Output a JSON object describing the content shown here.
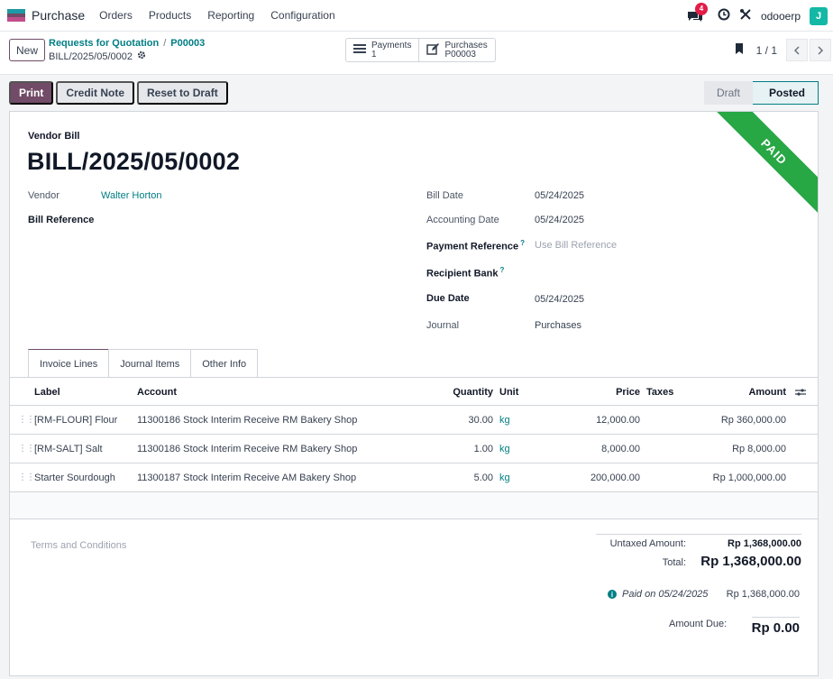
{
  "navbar": {
    "app_name": "Purchase",
    "menu": [
      "Orders",
      "Products",
      "Reporting",
      "Configuration"
    ],
    "chat_count": "4",
    "db_name": "odooerp",
    "avatar_initial": "J"
  },
  "control": {
    "new_label": "New",
    "breadcrumb": [
      "Requests for Quotation",
      "P00003"
    ],
    "breadcrumb_sep": "/",
    "record_name": "BILL/2025/05/0002",
    "smart_buttons": [
      {
        "label": "Payments",
        "value": "1",
        "icon": "list-icon"
      },
      {
        "label": "Purchases",
        "value": "P00003",
        "icon": "edit-icon"
      }
    ],
    "pager": "1 / 1"
  },
  "actions": {
    "print": "Print",
    "credit_note": "Credit Note",
    "reset_to_draft": "Reset to Draft"
  },
  "status": {
    "draft": "Draft",
    "posted": "Posted"
  },
  "ribbon": "PAID",
  "form": {
    "move_type": "Vendor Bill",
    "name": "BILL/2025/05/0002",
    "vendor_label": "Vendor",
    "vendor": "Walter Horton",
    "bill_reference_label": "Bill Reference",
    "bill_date_label": "Bill Date",
    "bill_date": "05/24/2025",
    "accounting_date_label": "Accounting Date",
    "accounting_date": "05/24/2025",
    "payment_reference_label": "Payment Reference",
    "payment_reference_placeholder": "Use Bill Reference",
    "recipient_bank_label": "Recipient Bank",
    "help_mark": "?",
    "due_date_label": "Due Date",
    "due_date": "05/24/2025",
    "journal_label": "Journal",
    "journal": "Purchases"
  },
  "tabs": [
    "Invoice Lines",
    "Journal Items",
    "Other Info"
  ],
  "lines": {
    "headers": {
      "label": "Label",
      "account": "Account",
      "quantity": "Quantity",
      "unit": "Unit",
      "price": "Price",
      "taxes": "Taxes",
      "amount": "Amount"
    },
    "rows": [
      {
        "label": "[RM-FLOUR] Flour",
        "account": "11300186 Stock Interim Receive RM Bakery Shop",
        "quantity": "30.00",
        "unit": "kg",
        "price": "12,000.00",
        "amount": "Rp 360,000.00"
      },
      {
        "label": "[RM-SALT] Salt",
        "account": "11300186 Stock Interim Receive RM Bakery Shop",
        "quantity": "1.00",
        "unit": "kg",
        "price": "8,000.00",
        "amount": "Rp 8,000.00"
      },
      {
        "label": "Starter Sourdough",
        "account": "11300187 Stock Interim Receive AM Bakery Shop",
        "quantity": "5.00",
        "unit": "kg",
        "price": "200,000.00",
        "amount": "Rp 1,000,000.00"
      }
    ]
  },
  "footer": {
    "terms_placeholder": "Terms and Conditions",
    "untaxed_label": "Untaxed Amount:",
    "untaxed_value": "Rp 1,368,000.00",
    "total_label": "Total:",
    "total_value": "Rp 1,368,000.00",
    "paid_text": "Paid on 05/24/2025",
    "paid_amount": "Rp 1,368,000.00",
    "amount_due_label": "Amount Due:",
    "amount_due_value": "Rp 0.00"
  },
  "colors": {
    "brand": "#714b67",
    "link": "#017e84",
    "paid": "#28a745",
    "badge": "#e11d48"
  }
}
